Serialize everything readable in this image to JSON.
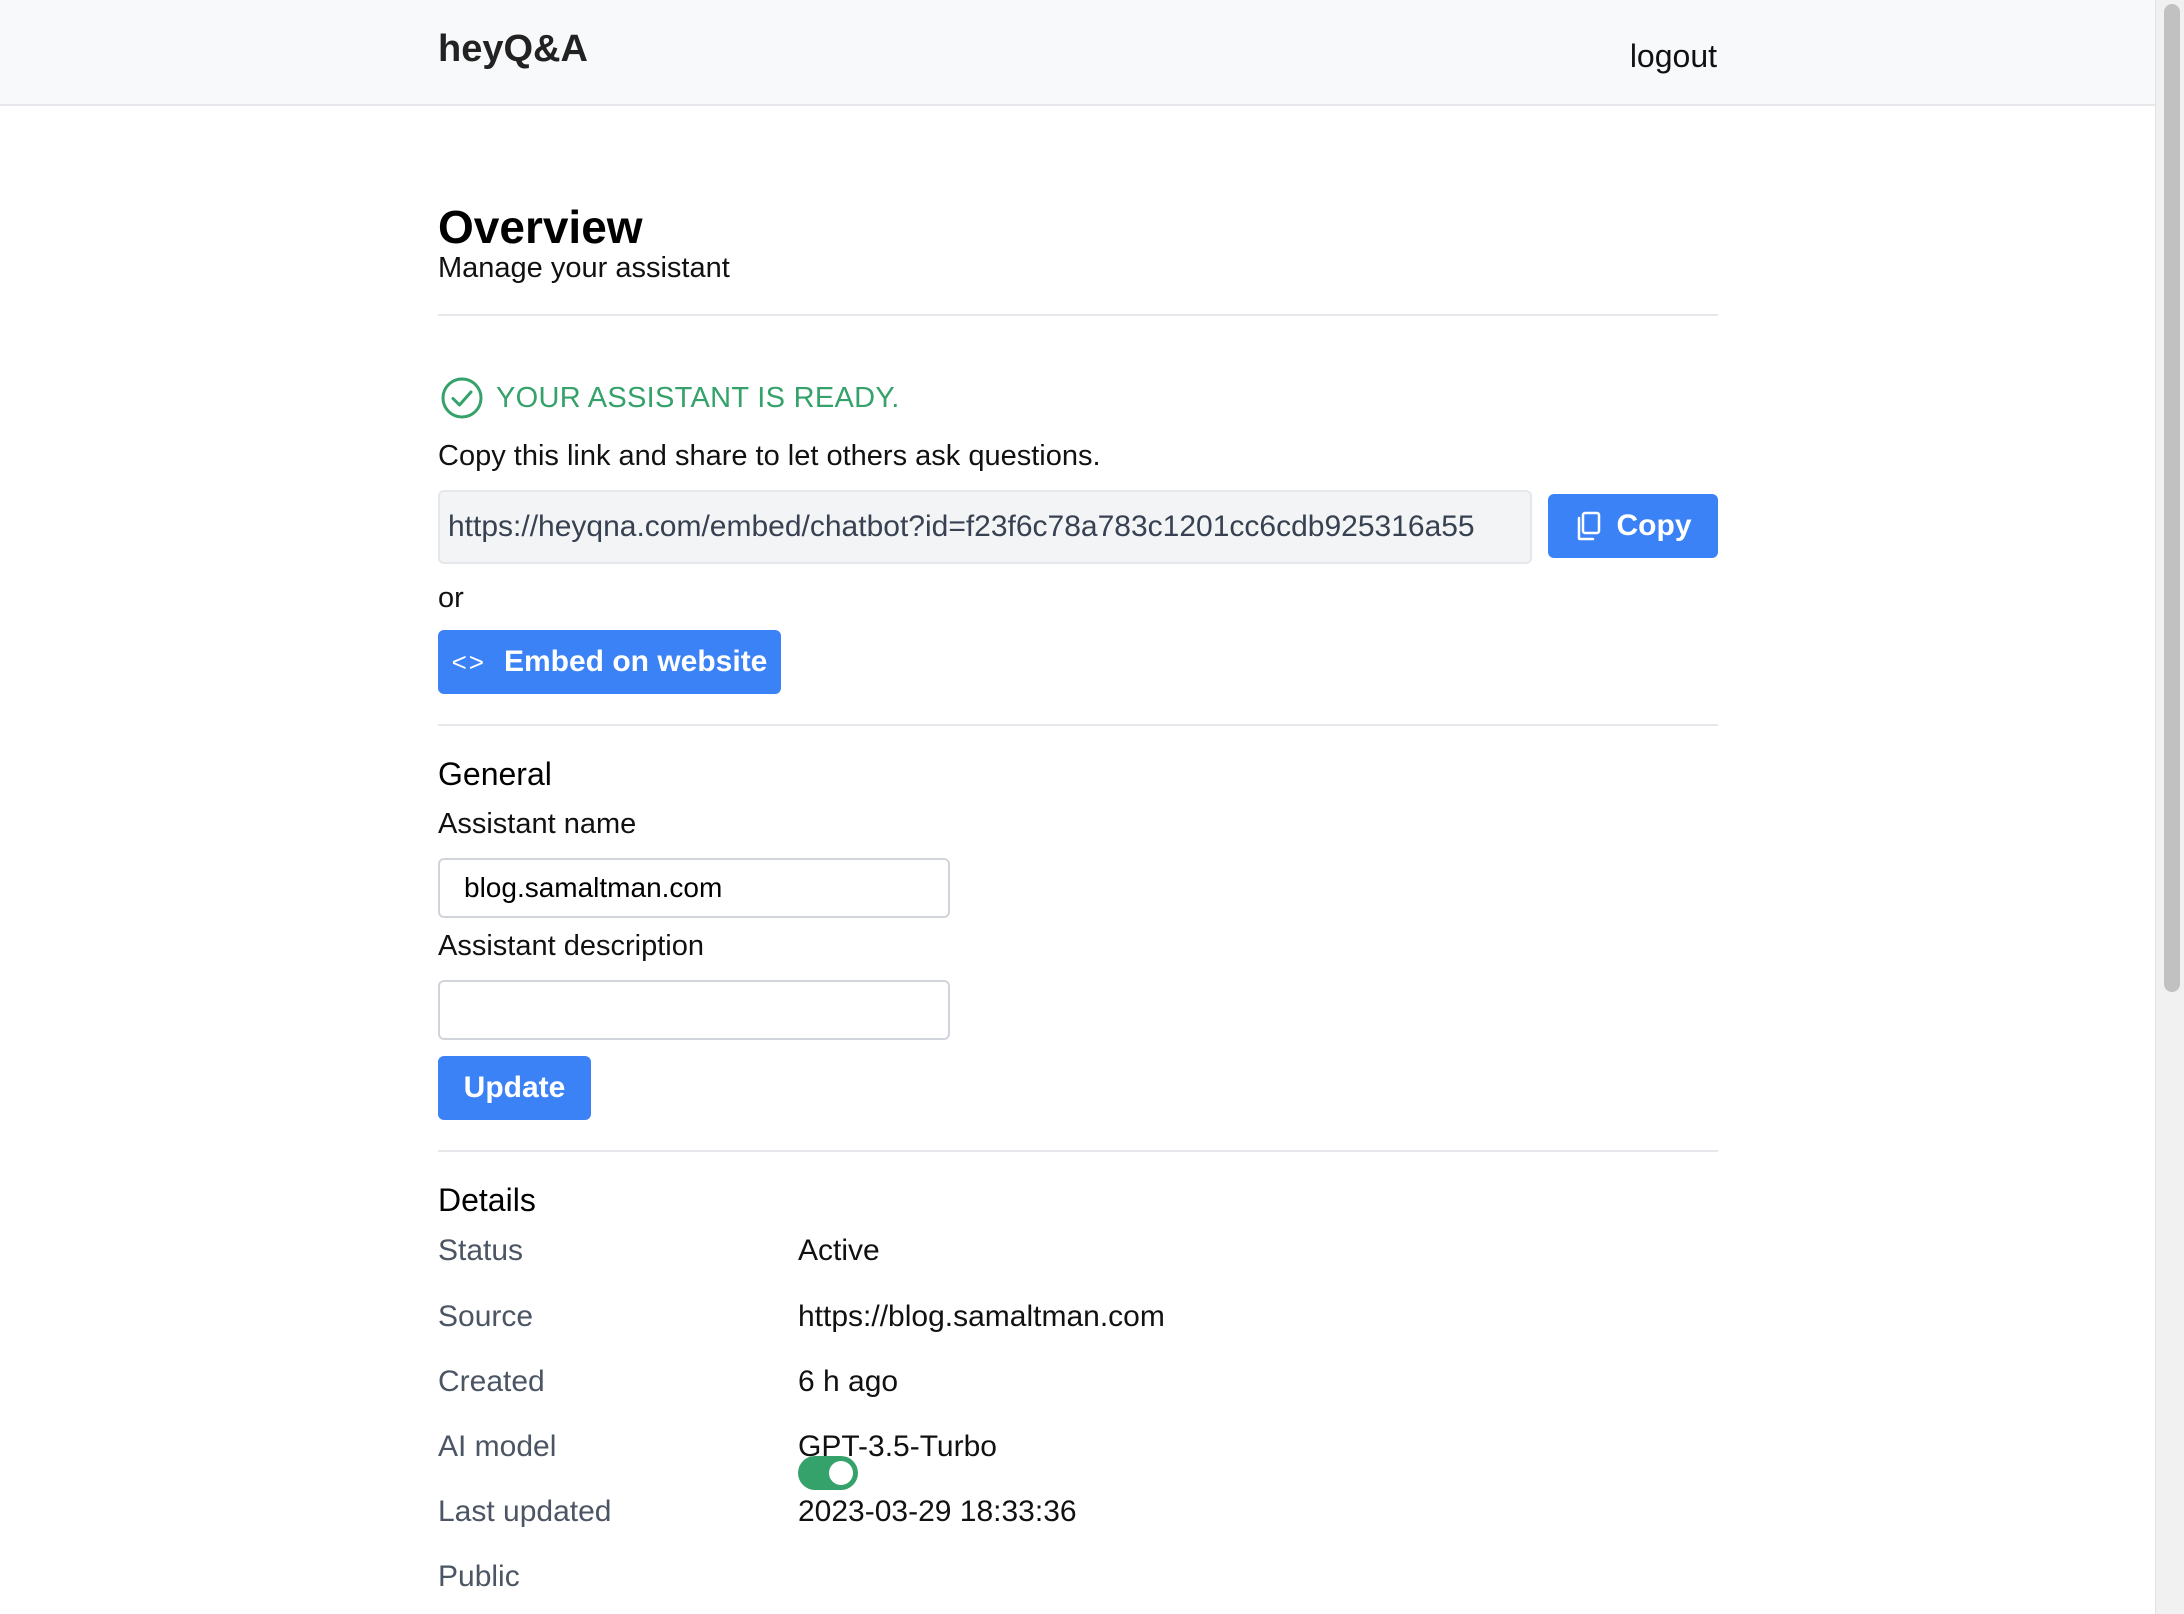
{
  "navbar": {
    "brand": "heyQ&A",
    "logout": "logout"
  },
  "header": {
    "title": "Overview",
    "subtitle": "Manage your assistant"
  },
  "share": {
    "status": "YOUR ASSISTANT IS READY.",
    "status_color": "#34a26a",
    "instructions": "Copy this link and share to let others ask questions.",
    "link": "https://heyqna.com/embed/chatbot?id=f23f6c78a783c1201cc6cdb925316a55",
    "copy_label": "Copy",
    "or_label": "or",
    "embed_label": "Embed on website",
    "embed_icon": "code-icon",
    "copy_icon": "copy-icon",
    "status_icon": "check-circle-icon"
  },
  "general": {
    "title": "General",
    "name_label": "Assistant name",
    "name_value": "blog.samaltman.com",
    "description_label": "Assistant description",
    "description_value": "",
    "update_label": "Update"
  },
  "details": {
    "title": "Details",
    "rows": [
      {
        "key": "Status",
        "value": "Active"
      },
      {
        "key": "Source",
        "value": "https://blog.samaltman.com"
      },
      {
        "key": "Created",
        "value": "6 h ago"
      },
      {
        "key": "AI model",
        "value": "GPT-3.5-Turbo"
      },
      {
        "key": "Last updated",
        "value": "2023-03-29 18:33:36"
      }
    ],
    "public_label": "Public",
    "public_enabled": true
  },
  "colors": {
    "primary": "#3b82f6",
    "success": "#34a26a"
  }
}
